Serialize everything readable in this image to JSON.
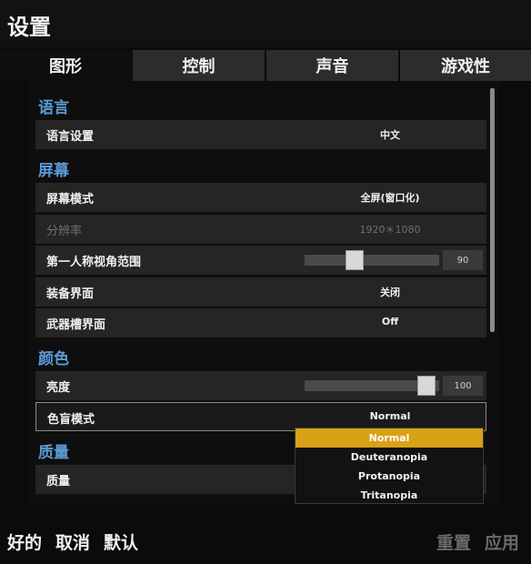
{
  "window": {
    "title": "设置"
  },
  "tabs": [
    {
      "label": "图形",
      "active": true
    },
    {
      "label": "控制",
      "active": false
    },
    {
      "label": "声音",
      "active": false
    },
    {
      "label": "游戏性",
      "active": false
    }
  ],
  "sections": {
    "language": {
      "heading": "语言",
      "language_setting": {
        "label": "语言设置",
        "value": "中文"
      }
    },
    "screen": {
      "heading": "屏幕",
      "screen_mode": {
        "label": "屏幕模式",
        "value": "全屏(窗口化)"
      },
      "resolution": {
        "label": "分辨率",
        "value": "1920＊1080"
      },
      "fov": {
        "label": "第一人称视角范围",
        "value": "90",
        "slider_fraction": 0.35
      },
      "inventory_ui": {
        "label": "装备界面",
        "value": "关闭"
      },
      "weapon_slot_ui": {
        "label": "武器槽界面",
        "value": "Off"
      }
    },
    "color": {
      "heading": "颜色",
      "brightness": {
        "label": "亮度",
        "value": "100",
        "slider_fraction": 0.97
      },
      "colorblind_mode": {
        "label": "色盲模式",
        "value": "Normal",
        "options": [
          "Normal",
          "Deuteranopia",
          "Protanopia",
          "Tritanopia"
        ],
        "selected_option": "Normal"
      }
    },
    "quality": {
      "heading": "质量",
      "quality": {
        "label": "质量"
      }
    }
  },
  "footer": {
    "ok": "好的",
    "cancel": "取消",
    "default": "默认",
    "reset": "重置",
    "apply": "应用"
  },
  "colors": {
    "section_heading": "#5c9bd6",
    "dropdown_selected": "#d9a116"
  }
}
